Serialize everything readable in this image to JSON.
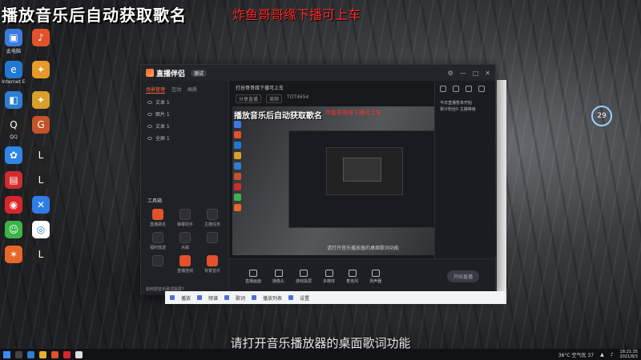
{
  "overlay": {
    "title": "播放音乐后自动获取歌名",
    "red_text": "炸鱼哥哥缘下播可上车",
    "subtitle": "请打开音乐播放器的桌面歌词功能"
  },
  "desktop_icons": [
    {
      "label": "此电脑",
      "icon": "computer-icon",
      "color": "#3b7be0",
      "glyph": "▣"
    },
    {
      "label": "",
      "icon": "app-icon",
      "color": "#e2522a",
      "glyph": "♪"
    },
    {
      "label": "Internet Explorer",
      "icon": "ie-icon",
      "color": "#1f78d1",
      "glyph": "e"
    },
    {
      "label": "",
      "icon": "app-icon",
      "color": "#e69a2a",
      "glyph": "✦"
    },
    {
      "label": "",
      "icon": "network-icon",
      "color": "#2d7fd3",
      "glyph": "◧"
    },
    {
      "label": "",
      "icon": "app-icon",
      "color": "#d8a02a",
      "glyph": "✦"
    },
    {
      "label": "QQ",
      "icon": "qq-icon",
      "color": "#222",
      "glyph": "Q"
    },
    {
      "label": "",
      "icon": "app-icon",
      "color": "#c4532a",
      "glyph": "G"
    },
    {
      "label": "",
      "icon": "app-icon",
      "color": "#2f86e8",
      "glyph": "✿"
    },
    {
      "label": "",
      "icon": "app-icon",
      "color": "#222",
      "glyph": "L"
    },
    {
      "label": "",
      "icon": "app-icon",
      "color": "#d12b2b",
      "glyph": "▤"
    },
    {
      "label": "",
      "icon": "app-icon",
      "color": "#222",
      "glyph": "L"
    },
    {
      "label": "",
      "icon": "netease-icon",
      "color": "#d8262b",
      "glyph": "◉"
    },
    {
      "label": "",
      "icon": "app-icon",
      "color": "#2f7ee8",
      "glyph": "✕"
    },
    {
      "label": "",
      "icon": "wechat-icon",
      "color": "#3bb44a",
      "glyph": "☺"
    },
    {
      "label": "",
      "icon": "baidu-icon",
      "color": "#fff",
      "glyph": "◎"
    },
    {
      "label": "",
      "icon": "app-icon",
      "color": "#e5672a",
      "glyph": "✶"
    },
    {
      "label": "",
      "icon": "app-icon",
      "color": "#222",
      "glyph": "L"
    }
  ],
  "weather": {
    "temp": "29"
  },
  "app": {
    "title": "直播伴侣",
    "badge": "测试",
    "scene_tabs": [
      "场景管理",
      "互动",
      "画质"
    ],
    "scenes": [
      "文本 1",
      "图片 1",
      "文本 1",
      "全屏 1"
    ],
    "tools_title": "工具箱",
    "tools": [
      "直播歌名",
      "弹幕助手",
      "主播任务",
      "福利放送",
      "点歌",
      "",
      "",
      "直播连线",
      "背景音乐"
    ],
    "tip": "如何把音乐歌词投屏?",
    "stream_title": "打扮哥哥缘下播可上车",
    "stream_chips": [
      "分享直播",
      "美颜",
      "TOT4654"
    ],
    "preview_title": "播放音乐后自动获取歌名",
    "preview_red": "炸鱼哥哥缘下播可上车",
    "preview_sub": "请打开音乐播放器的桌面歌词功能",
    "right_panel_text": [
      "今日直播暂未开始",
      "累计粉丝0  主播等级"
    ],
    "bottom_controls": [
      "直播画面",
      "摄像头",
      "游戏投屏",
      "多媒体",
      "麦克风",
      "扬声器"
    ],
    "start_label": "开始直播"
  },
  "music_bar": {
    "items": [
      "播放",
      "频谱",
      "歌词",
      "播放列表",
      "设置"
    ]
  },
  "taskbar": {
    "weather": "36°C 空气优 37",
    "time": "18:21:35",
    "date": "2021/8/3"
  }
}
